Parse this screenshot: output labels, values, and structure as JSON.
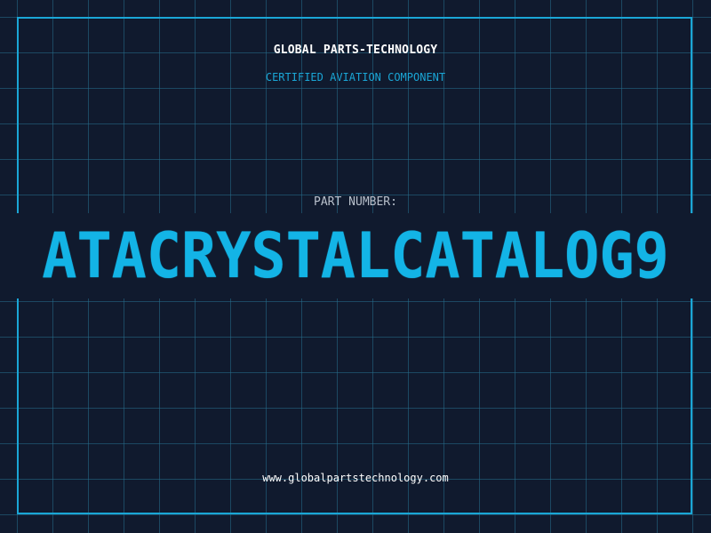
{
  "header": {
    "company": "GLOBAL PARTS-TECHNOLOGY",
    "subtitle": "CERTIFIED AVIATION COMPONENT"
  },
  "part": {
    "label": "PART NUMBER:",
    "value": "ATACRYSTALCATALOG9"
  },
  "footer": {
    "url": "www.globalpartstechnology.com"
  },
  "colors": {
    "background": "#101a2e",
    "grid": "#266e8c",
    "accent": "#13b4e6",
    "frame": "#1aa6d6",
    "text_primary": "#ffffff",
    "text_muted": "#b9c1cc"
  }
}
